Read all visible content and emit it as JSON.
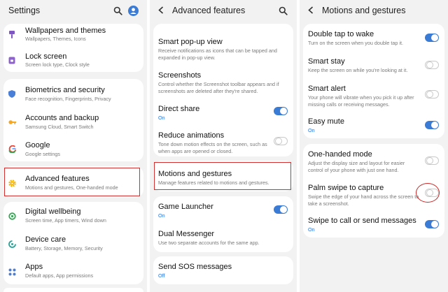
{
  "colors": {
    "accent": "#3a7bd5",
    "highlight": "#d32f2f",
    "on_text": "#1a73e8"
  },
  "panel1": {
    "title": "Settings",
    "icons": [
      "search-icon",
      "profile-icon"
    ],
    "items": [
      {
        "title": "Wallpapers and themes",
        "subtitle": "Wallpapers, Themes, Icons",
        "icon": "paintbrush-icon",
        "color": "#7e57c2"
      },
      {
        "title": "Lock screen",
        "subtitle": "Screen lock type, Clock style",
        "icon": "lock-icon",
        "color": "#8e63c9"
      },
      {
        "title": "Biometrics and security",
        "subtitle": "Face recognition, Fingerprints, Privacy",
        "icon": "shield-icon",
        "color": "#4a7fd8"
      },
      {
        "title": "Accounts and backup",
        "subtitle": "Samsung Cloud, Smart Switch",
        "icon": "key-icon",
        "color": "#f5a623"
      },
      {
        "title": "Google",
        "subtitle": "Google settings",
        "icon": "google-icon",
        "color": "#4285f4"
      },
      {
        "title": "Advanced features",
        "subtitle": "Motions and gestures, One-handed mode",
        "icon": "gear-icon",
        "color": "#f5b400"
      },
      {
        "title": "Digital wellbeing",
        "subtitle": "Screen time, App timers, Wind down",
        "icon": "wellbeing-icon",
        "color": "#34a853"
      },
      {
        "title": "Device care",
        "subtitle": "Battery, Storage, Memory, Security",
        "icon": "device-care-icon",
        "color": "#26a69a"
      },
      {
        "title": "Apps",
        "subtitle": "Default apps, App permissions",
        "icon": "apps-grid-icon",
        "color": "#4a7fd8"
      }
    ]
  },
  "panel2": {
    "title": "Advanced features",
    "icons": [
      "back-icon",
      "search-icon"
    ],
    "items": [
      {
        "title": "Smart pop-up view",
        "subtitle": "Receive notifications as icons that can be tapped and expanded in pop-up view."
      },
      {
        "title": "Screenshots",
        "subtitle": "Control whether the Screenshot toolbar appears and if screenshots are deleted after they're shared."
      },
      {
        "title": "Direct share",
        "subtitle": "On",
        "toggle": true
      },
      {
        "title": "Reduce animations",
        "subtitle": "Tone down motion effects on the screen, such as when apps are opened or closed.",
        "toggle": false
      },
      {
        "title": "Motions and gestures",
        "subtitle": "Manage features related to motions and gestures."
      },
      {
        "title": "Game Launcher",
        "subtitle": "On",
        "toggle": true
      },
      {
        "title": "Dual Messenger",
        "subtitle": "Use two separate accounts for the same app."
      },
      {
        "title": "Send SOS messages",
        "subtitle": "Off"
      }
    ]
  },
  "panel3": {
    "title": "Motions and gestures",
    "icons": [
      "back-icon"
    ],
    "items": [
      {
        "title": "Double tap to wake",
        "subtitle": "Turn on the screen when you double tap it.",
        "toggle": true
      },
      {
        "title": "Smart stay",
        "subtitle": "Keep the screen on while you're looking at it.",
        "toggle": false
      },
      {
        "title": "Smart alert",
        "subtitle": "Your phone will vibrate when you pick it up after missing calls or receiving messages.",
        "toggle": false
      },
      {
        "title": "Easy mute",
        "subtitle": "On",
        "toggle": true
      },
      {
        "title": "One-handed mode",
        "subtitle": "Adjust the display size and layout for easier control of your phone with just one hand.",
        "toggle": false
      },
      {
        "title": "Palm swipe to capture",
        "subtitle": "Swipe the edge of your hand across the screen to take a screenshot.",
        "toggle": false
      },
      {
        "title": "Swipe to call or send messages",
        "subtitle": "On",
        "toggle": true
      }
    ]
  }
}
